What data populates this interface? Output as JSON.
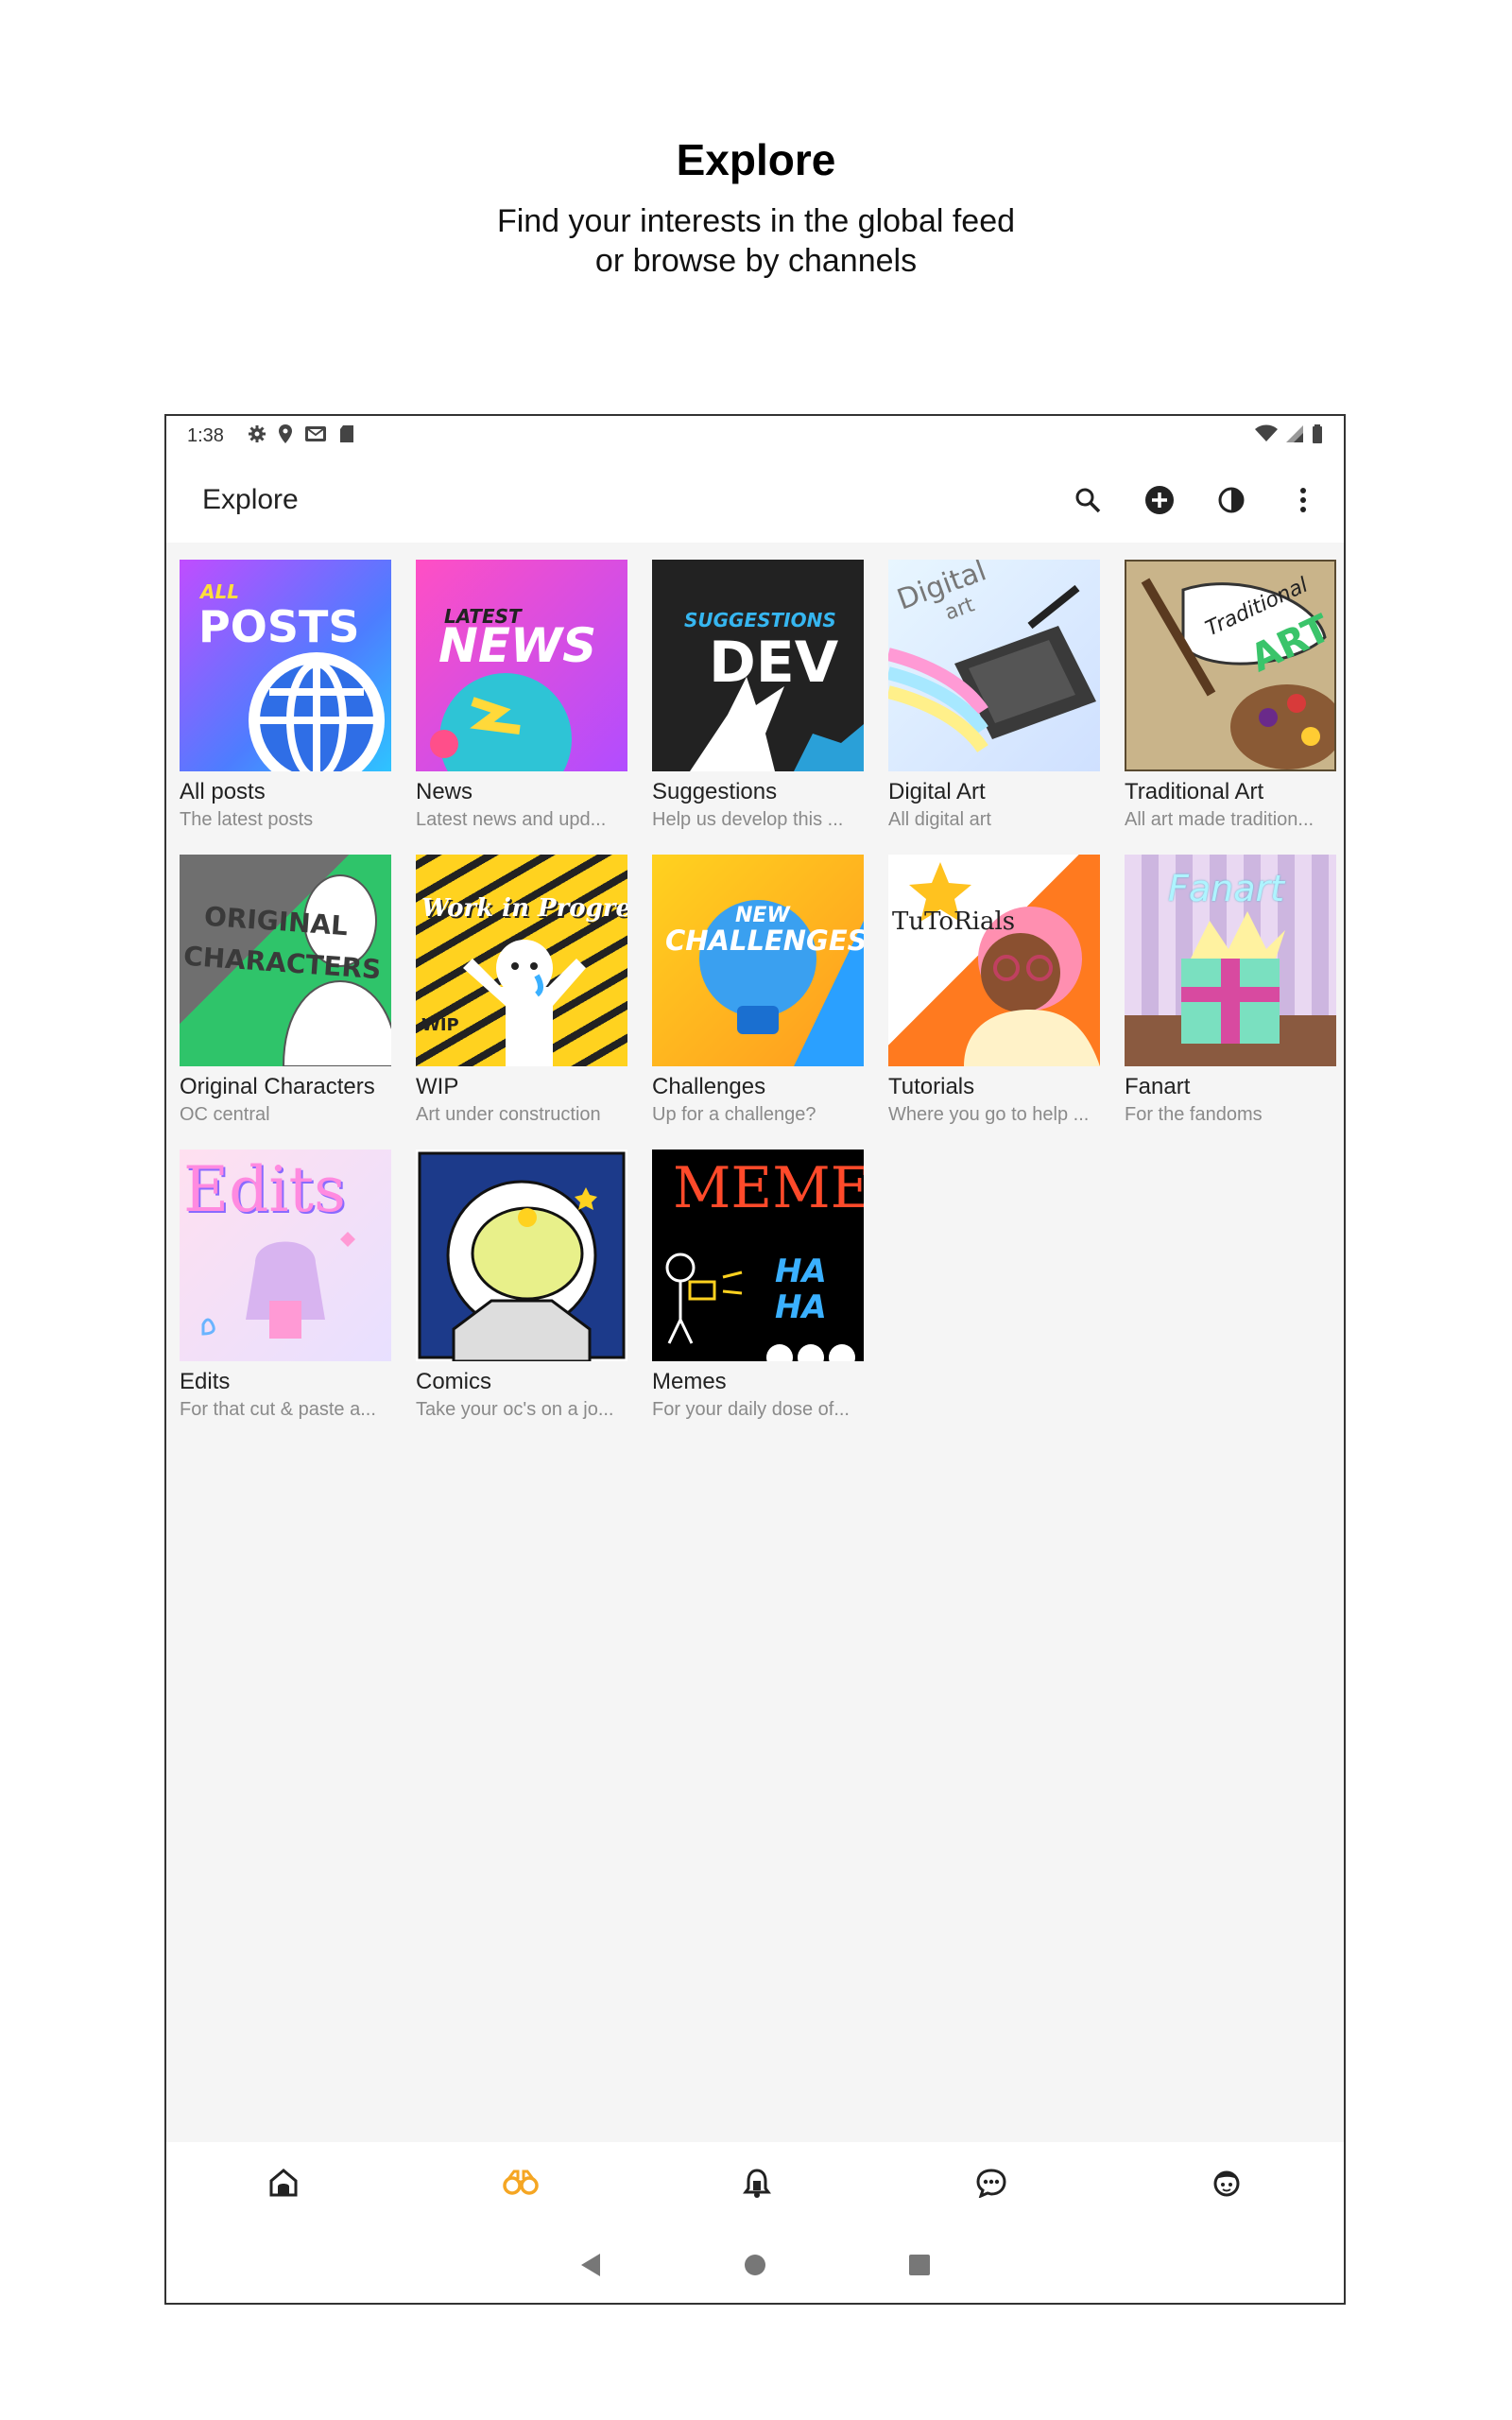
{
  "promo": {
    "title": "Explore",
    "subtitle_line1": "Find your interests in the global feed",
    "subtitle_line2": "or browse by channels"
  },
  "status_bar": {
    "time": "1:38",
    "left_icons": [
      "settings-icon",
      "location-icon",
      "mail-icon",
      "sd-card-icon"
    ],
    "right_icons": [
      "wifi-icon",
      "signal-icon",
      "battery-icon"
    ]
  },
  "app_bar": {
    "title": "Explore",
    "actions": [
      "search-icon",
      "add-circle-icon",
      "contrast-icon",
      "more-vert-icon"
    ]
  },
  "channels": [
    {
      "name": "All posts",
      "desc": "The latest posts",
      "thumb_text_1": "ALL",
      "thumb_text_2": "POSTS"
    },
    {
      "name": "News",
      "desc": "Latest news and upd...",
      "thumb_text_1": "LATEST",
      "thumb_text_2": "NEWS"
    },
    {
      "name": "Suggestions",
      "desc": "Help us develop this ...",
      "thumb_text_1": "SUGGESTIONS",
      "thumb_text_2": "DEV"
    },
    {
      "name": "Digital Art",
      "desc": "All digital art",
      "thumb_text_1": "Digital",
      "thumb_text_2": "art"
    },
    {
      "name": "Traditional Art",
      "desc": "All art made tradition...",
      "thumb_text_1": "Traditional",
      "thumb_text_2": "ART"
    },
    {
      "name": "Original Characters",
      "desc": "OC central",
      "thumb_text_1": "ORIGINAL",
      "thumb_text_2": "CHARACTERS"
    },
    {
      "name": "WIP",
      "desc": "Art under construction",
      "thumb_text_1": "Work in Progress",
      "thumb_text_2": "WIP"
    },
    {
      "name": "Challenges",
      "desc": "Up for a challenge?",
      "thumb_text_1": "NEW",
      "thumb_text_2": "CHALLENGES"
    },
    {
      "name": "Tutorials",
      "desc": "Where you go to help ...",
      "thumb_text_1": "TuToRials",
      "thumb_text_2": ""
    },
    {
      "name": "Fanart",
      "desc": "For the fandoms",
      "thumb_text_1": "Fanart",
      "thumb_text_2": ""
    },
    {
      "name": "Edits",
      "desc": "For that cut & paste a...",
      "thumb_text_1": "Edits",
      "thumb_text_2": ""
    },
    {
      "name": "Comics",
      "desc": "Take your oc's on a jo...",
      "thumb_text_1": "",
      "thumb_text_2": ""
    },
    {
      "name": "Memes",
      "desc": "For your daily dose of...",
      "thumb_text_1": "MEMES",
      "thumb_text_2": "HA HA"
    }
  ],
  "bottom_nav": [
    {
      "icon": "home-icon",
      "active": false
    },
    {
      "icon": "binoculars-icon",
      "active": true
    },
    {
      "icon": "bell-icon",
      "active": false
    },
    {
      "icon": "chat-icon",
      "active": false
    },
    {
      "icon": "profile-icon",
      "active": false
    }
  ],
  "system_nav": [
    "back-icon",
    "home-circle-icon",
    "recents-icon"
  ],
  "colors": {
    "accent": "#f5a623",
    "background": "#f5f5f5",
    "text_secondary": "#8a8a8a"
  }
}
